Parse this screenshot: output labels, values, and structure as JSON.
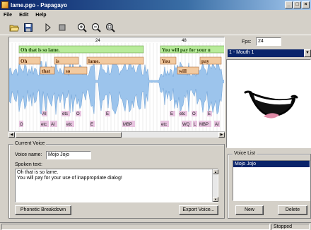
{
  "window": {
    "title": "lame.pgo - Papagayo"
  },
  "menu": [
    "File",
    "Edit",
    "Help"
  ],
  "toolbar": {
    "icons": [
      "open-icon",
      "save-icon",
      "play-icon",
      "stop-icon",
      "zoom-in-icon",
      "zoom-out-icon",
      "zoom-fit-icon"
    ]
  },
  "timeline": {
    "ruler_marks": [
      "24",
      "48"
    ],
    "phrases": [
      "Oh that is so lame.",
      "You will pay for your u"
    ],
    "words": [
      "Oh",
      "is",
      "lame.",
      "that",
      "so",
      "You",
      "pay",
      "will"
    ],
    "phonemes": [
      "AI",
      "etc",
      "O",
      "E",
      "etc",
      "O",
      "E",
      "MBP",
      "U",
      "WQ",
      "L",
      "MBP",
      "etc",
      "etc",
      "etc",
      "etc",
      "E",
      "E",
      "AI"
    ]
  },
  "fps": {
    "label": "Fps:",
    "value": "24"
  },
  "mouth": {
    "selected": "1 - Mouth 1"
  },
  "current_voice": {
    "legend": "Current Voice",
    "name_label": "Voice name:",
    "name_value": "Mojo Jojo",
    "spoken_label": "Spoken text:",
    "spoken_line1": "Oh that is so lame.",
    "spoken_line2": "You will pay for your use of inappropriate dialog!",
    "breakdown_button": "Phonetic Breakdown",
    "export_button": "Export Voice..."
  },
  "voice_list": {
    "legend": "Voice List",
    "items": [
      "Mojo Jojo"
    ],
    "new_button": "New",
    "delete_button": "Delete"
  },
  "status": {
    "text": "Stopped"
  },
  "colors": {
    "phrase": "#b8eb9a",
    "word": "#f2caa0",
    "phoneme": "#e8c4e0",
    "wave": "#9cc4ec",
    "title_active": "#0a246a"
  }
}
